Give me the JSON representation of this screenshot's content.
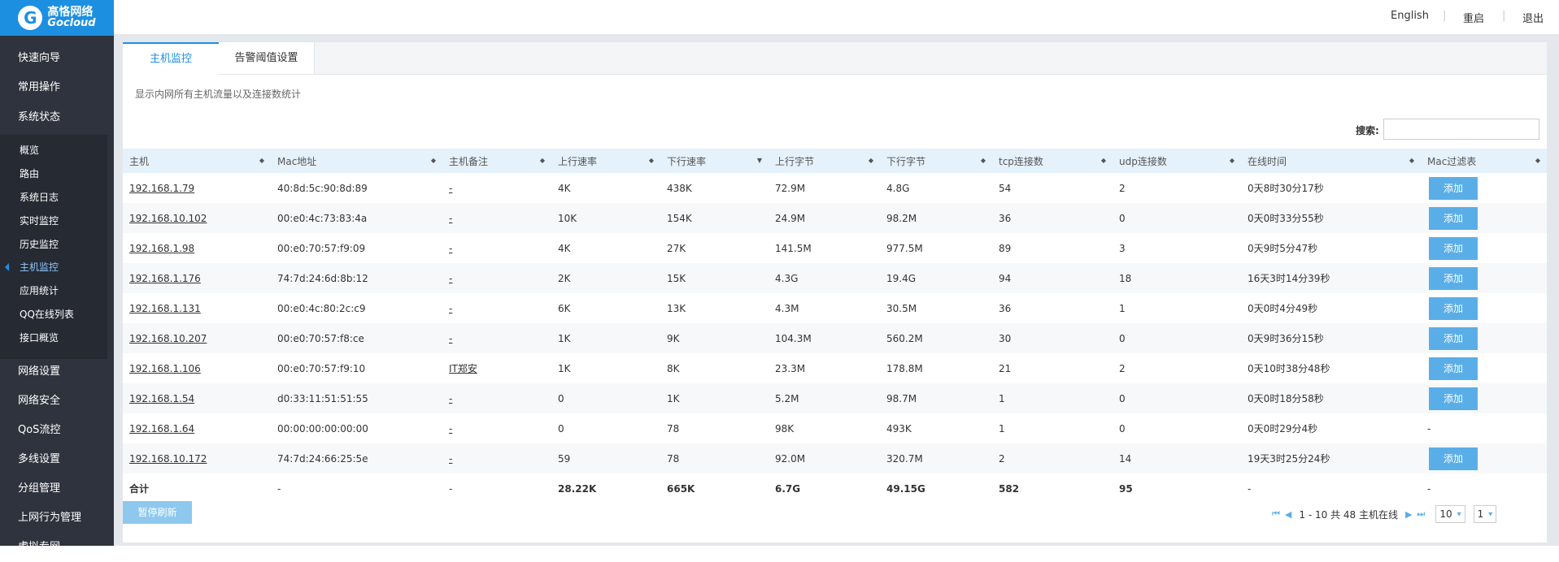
{
  "brand": {
    "name_cn": "高恪网络",
    "name_en": "Gocloud",
    "mark": "G"
  },
  "topbar": {
    "english": "English",
    "restart": "重启",
    "logout": "退出",
    "sep": "|"
  },
  "sidebar": {
    "menu_top": [
      "快速向导",
      "常用操作",
      "系统状态"
    ],
    "submenu": [
      "概览",
      "路由",
      "系统日志",
      "实时监控",
      "历史监控",
      "主机监控",
      "应用统计",
      "QQ在线列表",
      "接口概览"
    ],
    "menu_bottom": [
      "网络设置",
      "网络安全",
      "QoS流控",
      "多线设置",
      "分组管理",
      "上网行为管理",
      "虚拟专网"
    ]
  },
  "tabs": [
    "主机监控",
    "告警阈值设置"
  ],
  "description": "显示内网所有主机流量以及连接数统计",
  "search": {
    "label": "搜索:",
    "value": ""
  },
  "table": {
    "headers": [
      "主机",
      "Mac地址",
      "主机备注",
      "上行速率",
      "下行速率",
      "上行字节",
      "下行字节",
      "tcp连接数",
      "udp连接数",
      "在线时间",
      "Mac过滤表"
    ],
    "sort_icons": [
      "◆",
      "◆",
      "◆",
      "◆",
      "▼",
      "◆",
      "◆",
      "◆",
      "◆",
      "◆",
      "◆"
    ],
    "rows": [
      [
        "192.168.1.79",
        "40:8d:5c:90:8d:89",
        "-",
        "4K",
        "438K",
        "72.9M",
        "4.8G",
        "54",
        "2",
        "0天8时30分17秒",
        "添加"
      ],
      [
        "192.168.10.102",
        "00:e0:4c:73:83:4a",
        "-",
        "10K",
        "154K",
        "24.9M",
        "98.2M",
        "36",
        "0",
        "0天0时33分55秒",
        "添加"
      ],
      [
        "192.168.1.98",
        "00:e0:70:57:f9:09",
        "-",
        "4K",
        "27K",
        "141.5M",
        "977.5M",
        "89",
        "3",
        "0天9时5分47秒",
        "添加"
      ],
      [
        "192.168.1.176",
        "74:7d:24:6d:8b:12",
        "-",
        "2K",
        "15K",
        "4.3G",
        "19.4G",
        "94",
        "18",
        "16天3时14分39秒",
        "添加"
      ],
      [
        "192.168.1.131",
        "00:e0:4c:80:2c:c9",
        "-",
        "6K",
        "13K",
        "4.3M",
        "30.5M",
        "36",
        "1",
        "0天0时4分49秒",
        "添加"
      ],
      [
        "192.168.10.207",
        "00:e0:70:57:f8:ce",
        "-",
        "1K",
        "9K",
        "104.3M",
        "560.2M",
        "30",
        "0",
        "0天9时36分15秒",
        "添加"
      ],
      [
        "192.168.1.106",
        "00:e0:70:57:f9:10",
        "IT郑安",
        "1K",
        "8K",
        "23.3M",
        "178.8M",
        "21",
        "2",
        "0天10时38分48秒",
        "添加"
      ],
      [
        "192.168.1.54",
        "d0:33:11:51:51:55",
        "-",
        "0",
        "1K",
        "5.2M",
        "98.7M",
        "1",
        "0",
        "0天0时18分58秒",
        "添加"
      ],
      [
        "192.168.1.64",
        "00:00:00:00:00:00",
        "-",
        "0",
        "78",
        "98K",
        "493K",
        "1",
        "0",
        "0天0时29分4秒",
        "-"
      ],
      [
        "192.168.10.172",
        "74:7d:24:66:25:5e",
        "-",
        "59",
        "78",
        "92.0M",
        "320.7M",
        "2",
        "14",
        "19天3时25分24秒",
        "添加"
      ]
    ],
    "total": [
      "合计",
      "-",
      "-",
      "28.22K",
      "665K",
      "6.7G",
      "49.15G",
      "582",
      "95",
      "-",
      "-"
    ]
  },
  "refresh_button": "暂停刷新",
  "pager": {
    "summary": "1 - 10 共 48 主机在线",
    "page_size": "10",
    "page": "1"
  }
}
